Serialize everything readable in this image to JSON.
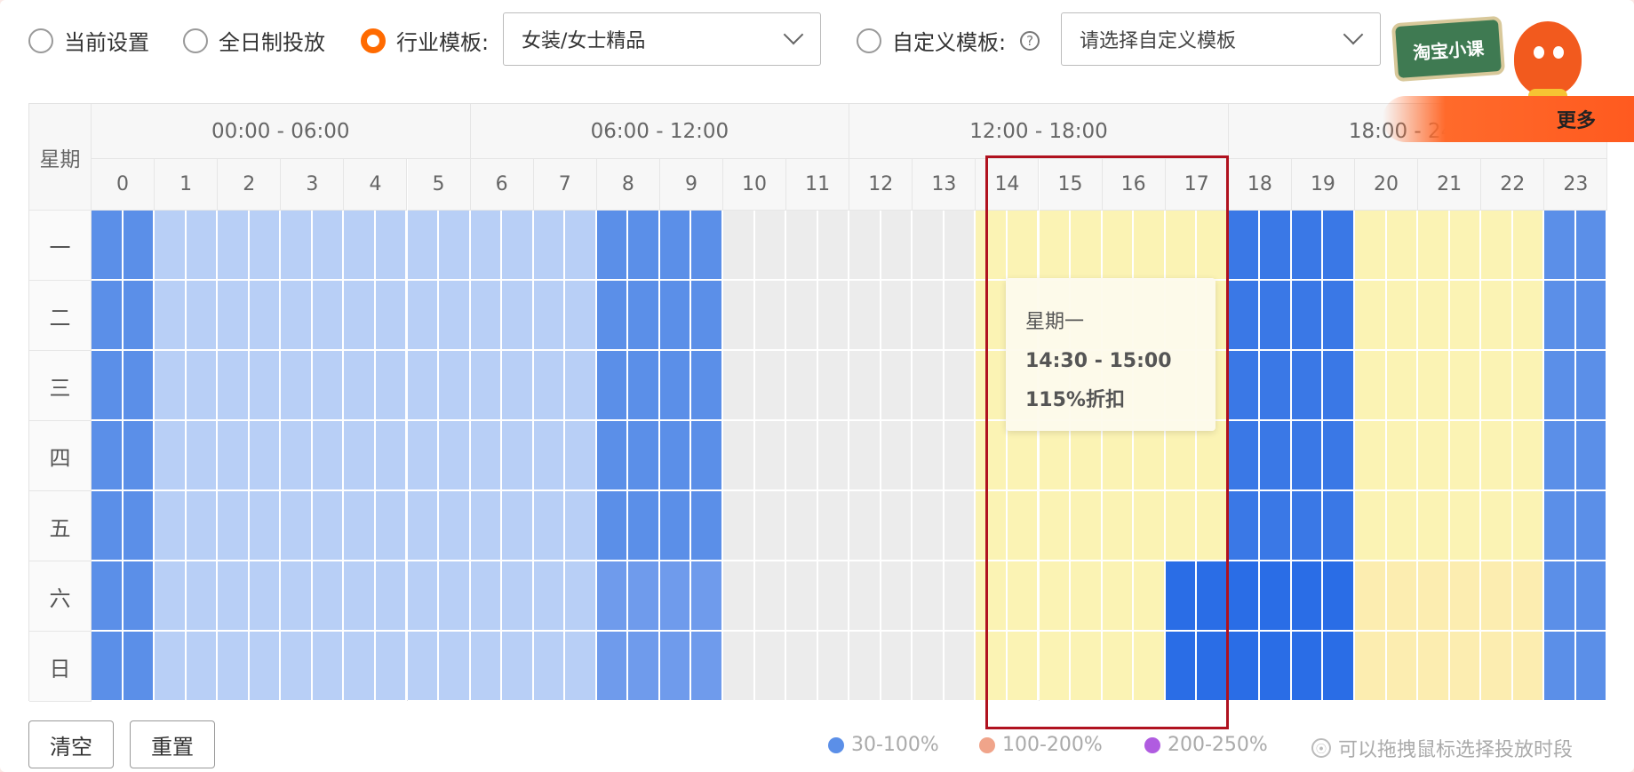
{
  "top_bar": {
    "radio_current": "当前设置",
    "radio_allday": "全日制投放",
    "radio_industry": "行业模板:",
    "industry_select_value": "女装/女士精品",
    "radio_custom": "自定义模板:",
    "help_icon_glyph": "?",
    "custom_select_placeholder": "请选择自定义模板",
    "selected_option": "行业模板"
  },
  "grid": {
    "weekday_header": "星期",
    "time_groups": [
      "00:00 - 06:00",
      "06:00 - 12:00",
      "12:00 - 18:00",
      "18:00 - 24:00"
    ],
    "hours": [
      "0",
      "1",
      "2",
      "3",
      "4",
      "5",
      "6",
      "7",
      "8",
      "9",
      "10",
      "11",
      "12",
      "13",
      "14",
      "15",
      "16",
      "17",
      "18",
      "19",
      "20",
      "21",
      "22",
      "23"
    ],
    "days": [
      "一",
      "二",
      "三",
      "四",
      "五",
      "六",
      "日"
    ],
    "hour_levels": [
      "mid",
      "light",
      "light",
      "light",
      "light",
      "light",
      "light",
      "light",
      "mid",
      "mid",
      "none",
      "none",
      "none",
      "none",
      "yellow",
      "yellow",
      "yellow",
      "yellow",
      "strong",
      "strong",
      "yellow",
      "yellow",
      "yellow",
      "mid"
    ],
    "weekend_levels": {
      "8": "mid_soft",
      "9": "mid_soft",
      "17": "deep",
      "18": "deep",
      "19": "deep",
      "20": "yellow_deep",
      "21": "yellow_deep",
      "22": "yellow_deep"
    },
    "colors": {
      "light": "#b8cff6",
      "mid": "#5b8fe8",
      "mid_soft": "#6f9bec",
      "strong": "#3a78e6",
      "deep": "#2a6de6",
      "none": "#ececec",
      "yellow": "#fbf3b4",
      "yellow_deep": "#fcedb0",
      "highlight": "#b0121f"
    }
  },
  "tooltip": {
    "day": "星期一",
    "time_range": "14:30 - 15:00",
    "discount": "115%折扣"
  },
  "actions": {
    "clear": "清空",
    "reset": "重置"
  },
  "legend": {
    "items": [
      {
        "label": "30-100%",
        "color": "#5b8fe8"
      },
      {
        "label": "100-200%",
        "color": "#f0a48a"
      },
      {
        "label": "200-250%",
        "color": "#b05ce0"
      }
    ],
    "hint": "可以拖拽鼠标选择投放时段"
  },
  "overlay": {
    "badge_text": "淘宝小课",
    "more_text": "更多"
  }
}
